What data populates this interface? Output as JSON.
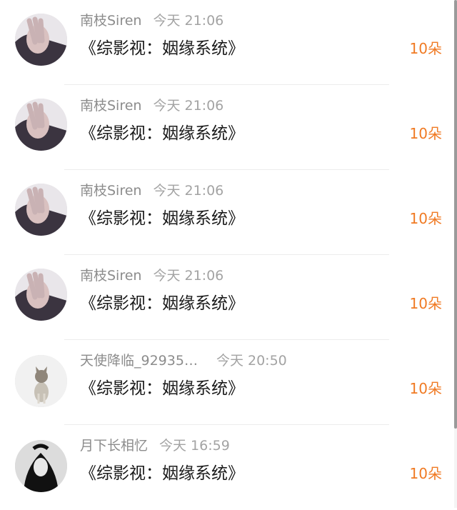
{
  "records": [
    {
      "name": "南枝Siren",
      "time": "今天 21:06",
      "book": "《综影视：姻缘系统》",
      "amount": "10朵",
      "avatar": "hand-avatar"
    },
    {
      "name": "南枝Siren",
      "time": "今天 21:06",
      "book": "《综影视：姻缘系统》",
      "amount": "10朵",
      "avatar": "hand-avatar"
    },
    {
      "name": "南枝Siren",
      "time": "今天 21:06",
      "book": "《综影视：姻缘系统》",
      "amount": "10朵",
      "avatar": "hand-avatar"
    },
    {
      "name": "南枝Siren",
      "time": "今天 21:06",
      "book": "《综影视：姻缘系统》",
      "amount": "10朵",
      "avatar": "hand-avatar"
    },
    {
      "name": "天使降临_92935…",
      "time": "今天 20:50",
      "book": "《综影视：姻缘系统》",
      "amount": "10朵",
      "avatar": "cat-avatar"
    },
    {
      "name": "月下长相忆",
      "time": "今天 16:59",
      "book": "《综影视：姻缘系统》",
      "amount": "10朵",
      "avatar": "girl-avatar"
    }
  ],
  "colors": {
    "accent": "#f07a23",
    "name": "#8c8c8c",
    "title": "#1a1a1a"
  }
}
